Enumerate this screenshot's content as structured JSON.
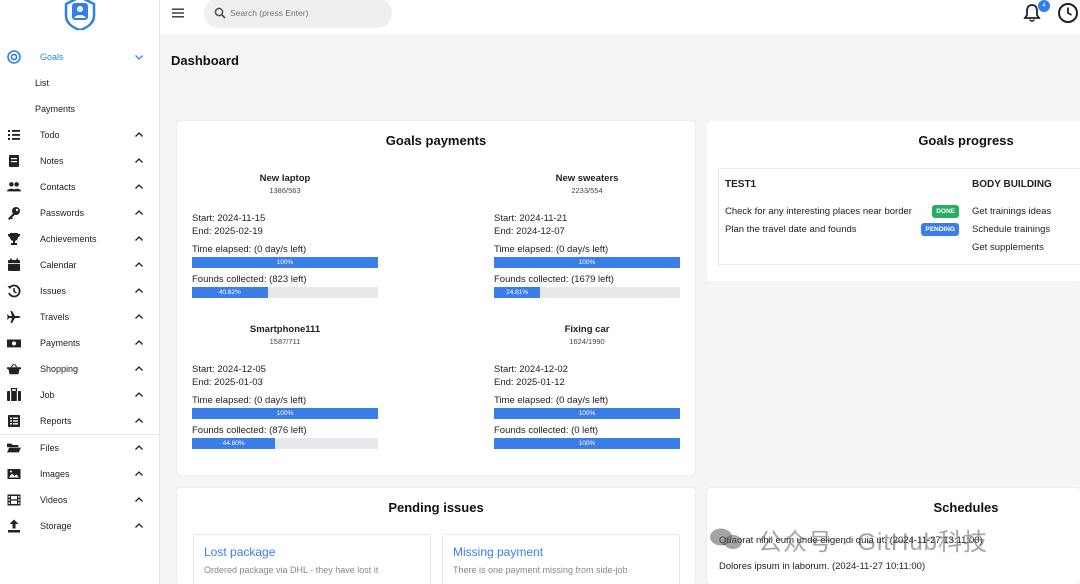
{
  "app": {
    "accent": "#2f80ed",
    "success": "#27ae60"
  },
  "topbar": {
    "search_placeholder": "Search (press Enter)",
    "notifications_count": "4"
  },
  "sidebar": {
    "items": [
      {
        "label": "Goals",
        "icon": "target-icon",
        "expanded": true
      },
      {
        "label": "Todo",
        "icon": "list-icon"
      },
      {
        "label": "Notes",
        "icon": "note-icon"
      },
      {
        "label": "Contacts",
        "icon": "users-icon"
      },
      {
        "label": "Passwords",
        "icon": "key-icon"
      },
      {
        "label": "Achievements",
        "icon": "trophy-icon"
      },
      {
        "label": "Calendar",
        "icon": "calendar-icon"
      },
      {
        "label": "Issues",
        "icon": "history-icon"
      },
      {
        "label": "Travels",
        "icon": "plane-icon"
      },
      {
        "label": "Payments",
        "icon": "money-icon"
      },
      {
        "label": "Shopping",
        "icon": "basket-icon"
      },
      {
        "label": "Job",
        "icon": "briefcase-icon"
      },
      {
        "label": "Reports",
        "icon": "report-icon"
      },
      {
        "label": "Files",
        "icon": "folder-icon"
      },
      {
        "label": "Images",
        "icon": "image-icon"
      },
      {
        "label": "Videos",
        "icon": "film-icon"
      },
      {
        "label": "Storage",
        "icon": "upload-icon"
      }
    ],
    "goals_sub": [
      "List",
      "Payments"
    ]
  },
  "page": {
    "title": "Dashboard"
  },
  "goals_payments": {
    "title": "Goals payments",
    "goals": [
      {
        "name": "New laptop",
        "value": "1386/563",
        "start": "Start: 2024-11-15",
        "end": "End: 2025-02-19",
        "time_label": "Time elapsed: (0 day/s left)",
        "time_pct": 1.0,
        "time_text": "100%",
        "funds_label": "Founds collected: (823 left)",
        "funds_pct": 0.4062,
        "funds_text": "40.62%"
      },
      {
        "name": "New sweaters",
        "value": "2233/554",
        "start": "Start: 2024-11-21",
        "end": "End: 2024-12-07",
        "time_label": "Time elapsed: (0 day/s left)",
        "time_pct": 1.0,
        "time_text": "100%",
        "funds_label": "Founds collected: (1679 left)",
        "funds_pct": 0.2481,
        "funds_text": "24.81%"
      },
      {
        "name": "Smartphone111",
        "value": "1587/711",
        "start": "Start: 2024-12-05",
        "end": "End: 2025-01-03",
        "time_label": "Time elapsed: (0 day/s left)",
        "time_pct": 1.0,
        "time_text": "100%",
        "funds_label": "Founds collected: (876 left)",
        "funds_pct": 0.448,
        "funds_text": "44.80%"
      },
      {
        "name": "Fixing car",
        "value": "1624/1990",
        "start": "Start: 2024-12-02",
        "end": "End: 2025-01-12",
        "time_label": "Time elapsed: (0 day/s left)",
        "time_pct": 1.0,
        "time_text": "100%",
        "funds_label": "Founds collected: (0 left)",
        "funds_pct": 1.0,
        "funds_text": "100%"
      }
    ]
  },
  "goals_progress": {
    "title": "Goals progress",
    "groups": [
      {
        "name": "TEST1",
        "tasks": [
          {
            "text": "Check for any interesting places near border",
            "status": "DONE"
          },
          {
            "text": "Plan the travel date and founds",
            "status": "PENDING"
          }
        ]
      },
      {
        "name": "BODY BUILDING",
        "tasks": [
          {
            "text": "Get trainings ideas"
          },
          {
            "text": "Schedule trainings"
          },
          {
            "text": "Get supplements"
          }
        ]
      }
    ]
  },
  "pending_issues": {
    "title": "Pending issues",
    "issues": [
      {
        "title": "Lost package",
        "desc": "Ordered package via DHL - they have lost it"
      },
      {
        "title": "Missing payment",
        "desc": "There is one payment missing from side-job"
      }
    ]
  },
  "schedules": {
    "title": "Schedules",
    "items": [
      "Quaorat nihil eum unde eligendi quia ut. (2024-11-27 13:11:00)",
      "Dolores ipsum in laborum. (2024-11-27 10:11:00)"
    ]
  },
  "watermark": {
    "text": "公众号 · GitHub科技"
  }
}
